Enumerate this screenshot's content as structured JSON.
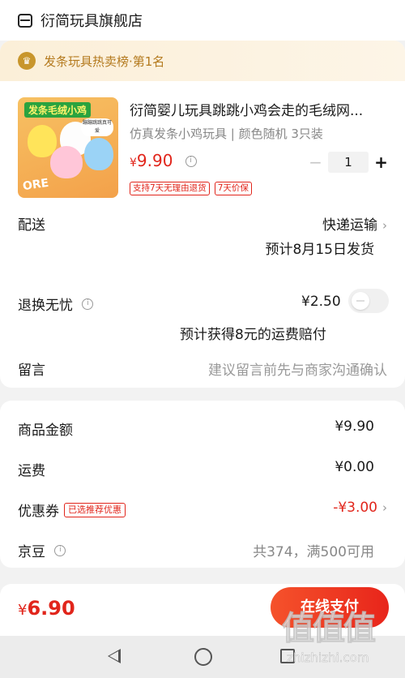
{
  "header": {
    "store_name": "衍简玩具旗舰店"
  },
  "rank": {
    "text": "发条玩具热卖榜·第1名"
  },
  "product": {
    "thumb_title": "发条毛绒小鸡",
    "thumb_bubble": "蹦蹦跳跳真可爱",
    "thumb_store": "ORE",
    "title": "衍简婴儿玩具跳跳小鸡会走的毛绒网...",
    "spec": "仿真发条小鸡玩具 | 颜色随机 3只装",
    "price_currency": "¥",
    "price_amount": "9.90",
    "quantity": "1",
    "qty_minus": "−",
    "qty_plus": "+",
    "tags": [
      "支持7天无理由退货",
      "7天价保"
    ]
  },
  "shipping": {
    "label": "配送",
    "method": "快递运输",
    "estimate": "预计8月15日发货"
  },
  "returns": {
    "label": "退换无忧",
    "price": "¥2.50",
    "toggle_on": false,
    "note": "预计获得8元的运费赔付"
  },
  "message": {
    "label": "留言",
    "placeholder": "建议留言前先与商家沟通确认"
  },
  "summary": {
    "goods_label": "商品金额",
    "goods_value": "¥9.90",
    "freight_label": "运费",
    "freight_value": "¥0.00",
    "coupon_label": "优惠券",
    "coupon_tag": "已选推荐优惠",
    "coupon_value": "-¥3.00",
    "jd_label": "京豆",
    "jd_value": "共374，满500可用"
  },
  "footer": {
    "total_currency": "¥",
    "total_amount": "6.90",
    "pay_label": "在线支付"
  },
  "watermark": {
    "logo": "值值值",
    "url": "zhizhizhi.com"
  },
  "colors": {
    "accent_red": "#e1251b",
    "rank_gold": "#b47a1e",
    "rank_bg": "#fbefd8"
  },
  "icons": [
    "store-icon",
    "trophy-icon",
    "info-icon",
    "chevron-right-icon",
    "back-icon",
    "home-icon",
    "recent-apps-icon"
  ]
}
